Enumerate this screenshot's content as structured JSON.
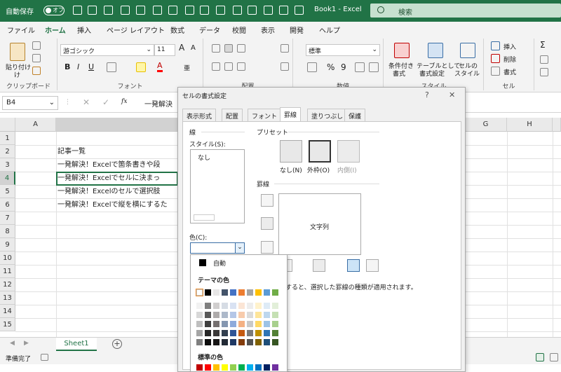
{
  "titlebar": {
    "autosave_label": "自動保存",
    "autosave_state": "オフ",
    "doc_title": "Book1  -  Excel",
    "search_placeholder": "検索"
  },
  "menu": {
    "tabs": [
      "ファイル",
      "ホーム",
      "挿入",
      "ページ レイアウト",
      "数式",
      "データ",
      "校閲",
      "表示",
      "開発",
      "ヘルプ"
    ],
    "active_index": 1
  },
  "ribbon": {
    "clipboard": {
      "paste_label": "貼り付け",
      "paste_sub": "け",
      "group_label": "クリップボード"
    },
    "font": {
      "font_name": "游ゴシック",
      "font_size": "11",
      "grow_label": "A",
      "shrink_label": "A",
      "bold": "B",
      "italic": "I",
      "underline": "U",
      "font_color_letter": "A",
      "phonetic": "亜",
      "group_label": "フォント"
    },
    "alignment": {
      "group_label": "配置"
    },
    "number": {
      "format": "標準",
      "percent": "%",
      "comma": "9",
      "group_label": "数値"
    },
    "styles": {
      "conditional": "条件付き",
      "conditional_sub": "書式",
      "table": "テーブルとして",
      "table_sub": "書式設定",
      "cell_style": "セルの",
      "cell_style_sub": "スタイル",
      "group_label": "スタイル"
    },
    "cells": {
      "insert": "挿入",
      "delete": "削除",
      "format": "書式",
      "group_label": "セル"
    },
    "editing": {
      "sum": "Σ"
    }
  },
  "formula_bar": {
    "cell_ref": "B4",
    "fx": "fx",
    "content": "一発解決"
  },
  "grid": {
    "columns": [
      "A",
      "",
      "G",
      "H"
    ],
    "rows": [
      "1",
      "2",
      "3",
      "4",
      "5",
      "6",
      "7",
      "8",
      "9",
      "10",
      "11",
      "12",
      "13",
      "14",
      "15"
    ],
    "selected_row": "4",
    "cells": [
      {
        "row": 2,
        "text": "記事一覧"
      },
      {
        "row": 3,
        "text": "一発解決！Excelで箇条書きや段"
      },
      {
        "row": 4,
        "text": "一発解決！Excelでセルに決まっ"
      },
      {
        "row": 5,
        "text": "一発解決！Excelのセルで選択肢"
      },
      {
        "row": 6,
        "text": "一発解決！Excelで縦を横にするた"
      }
    ]
  },
  "sheets": {
    "tab": "Sheet1",
    "add": "+"
  },
  "status": {
    "text": "準備完了"
  },
  "dialog": {
    "title": "セルの書式設定",
    "help": "?",
    "close": "✕",
    "tabs": [
      "表示形式",
      "配置",
      "フォント",
      "罫線",
      "塗りつぶし",
      "保護"
    ],
    "active_tab": 3,
    "line_section": "線",
    "style_label": "スタイル(S):",
    "style_none": "なし",
    "color_label": "色(C):",
    "preset_label": "プリセット",
    "preset_buttons": [
      "なし(N)",
      "外枠(O)",
      "内側(I)"
    ],
    "border_label": "罫線",
    "preview_text": "文字列",
    "hint_prefix": "プ",
    "hint_text": "すると、選択した罫線の種類が適用されます。"
  },
  "palette": {
    "auto_label": "自動",
    "theme_label": "テーマの色",
    "standard_label": "標準の色",
    "theme_top": [
      "#ffffff",
      "#000000",
      "#e7e6e6",
      "#44546a",
      "#4472c4",
      "#ed7d31",
      "#a5a5a5",
      "#ffc000",
      "#5b9bd5",
      "#70ad47"
    ],
    "theme_shades": [
      [
        "#f2f2f2",
        "#7f7f7f",
        "#d0cece",
        "#d6dce4",
        "#d9e2f3",
        "#fbe5d5",
        "#ededed",
        "#fff2cc",
        "#deebf6",
        "#e2efd9"
      ],
      [
        "#d8d8d8",
        "#595959",
        "#aeabab",
        "#adb9ca",
        "#b4c6e7",
        "#f7cbac",
        "#dbdbdb",
        "#fee599",
        "#bdd7ee",
        "#c5e0b3"
      ],
      [
        "#bfbfbf",
        "#3f3f3f",
        "#757070",
        "#8496b0",
        "#8eaadb",
        "#f4b183",
        "#c9c9c9",
        "#ffd965",
        "#9dc3e6",
        "#a8d08d"
      ],
      [
        "#a5a5a5",
        "#262626",
        "#3a3838",
        "#323f4f",
        "#2f5496",
        "#c55a11",
        "#7b7b7b",
        "#bf9000",
        "#2e75b5",
        "#538135"
      ],
      [
        "#7f7f7f",
        "#0c0c0c",
        "#171616",
        "#222a35",
        "#1f3864",
        "#833c0b",
        "#525252",
        "#7f6000",
        "#1e4e79",
        "#375623"
      ]
    ],
    "standard": [
      "#c00000",
      "#ff0000",
      "#ffc000",
      "#ffff00",
      "#92d050",
      "#00b050",
      "#00b0f0",
      "#0070c0",
      "#002060",
      "#7030a0"
    ]
  }
}
